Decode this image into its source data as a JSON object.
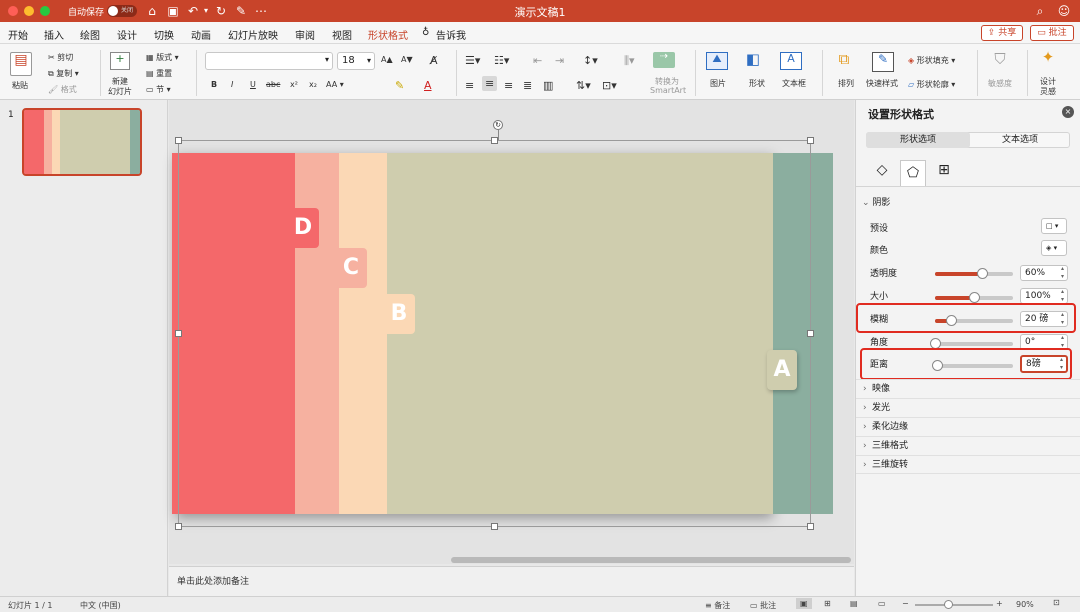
{
  "window": {
    "title": "演示文稿1",
    "autosave_label": "自动保存",
    "autosave_state": "关闭"
  },
  "tabs": [
    "开始",
    "插入",
    "绘图",
    "设计",
    "切换",
    "动画",
    "幻灯片放映",
    "审阅",
    "视图",
    "形状格式",
    "告诉我"
  ],
  "share": {
    "share_label": "共享",
    "comment_label": "批注"
  },
  "ribbon": {
    "paste": "粘贴",
    "cut": "剪切",
    "copy": "复制",
    "format": "格式",
    "new_slide_1": "新建",
    "new_slide_2": "幻灯片",
    "layout": "版式",
    "reset": "重置",
    "section": "节",
    "font_name": "",
    "font_size": "18",
    "bold": "B",
    "italic": "I",
    "underline": "U",
    "strike": "abc",
    "superscript": "x²",
    "subscript": "x₂",
    "aa": "AA",
    "convert_1": "转换为",
    "convert_2": "SmartArt",
    "picture": "图片",
    "shape": "形状",
    "textbox": "文本框",
    "arrange": "排列",
    "quick_styles": "快速样式",
    "shape_fill": "形状填充",
    "shape_outline": "形状轮廓",
    "sensitivity": "敏感度",
    "designer_1": "设计",
    "designer_2": "灵感"
  },
  "thumbnail": {
    "number": "1"
  },
  "slide": {
    "letters": [
      "D",
      "C",
      "B",
      "A"
    ]
  },
  "notes": {
    "placeholder": "单击此处添加备注"
  },
  "panel": {
    "title": "设置形状格式",
    "tabs": [
      "形状选项",
      "文本选项"
    ],
    "section_shadow": "阴影",
    "rows": [
      {
        "label": "预设"
      },
      {
        "label": "颜色"
      },
      {
        "label": "透明度",
        "value": "60%",
        "level": 0.6
      },
      {
        "label": "大小",
        "value": "100%",
        "level": 0.5
      },
      {
        "label": "模糊",
        "value": "20 磅",
        "level": 0.2
      },
      {
        "label": "角度",
        "value": "0°",
        "level": 0.0
      },
      {
        "label": "距离",
        "value": "8磅",
        "level": 0.02
      }
    ],
    "sections": [
      "映像",
      "发光",
      "柔化边缘",
      "三维格式",
      "三维旋转"
    ]
  },
  "status": {
    "slide_info": "幻灯片 1 / 1",
    "language": "中文 (中国)",
    "notes": "备注",
    "comments": "批注",
    "zoom": "90%"
  },
  "colors": {
    "accent": "#c8442a",
    "red_band": "#f4686a",
    "salmon_band": "#f6b1a0",
    "peach_band": "#fbd8b5",
    "olive_bg": "#cfcdae",
    "teal_band": "#8bae9f"
  }
}
